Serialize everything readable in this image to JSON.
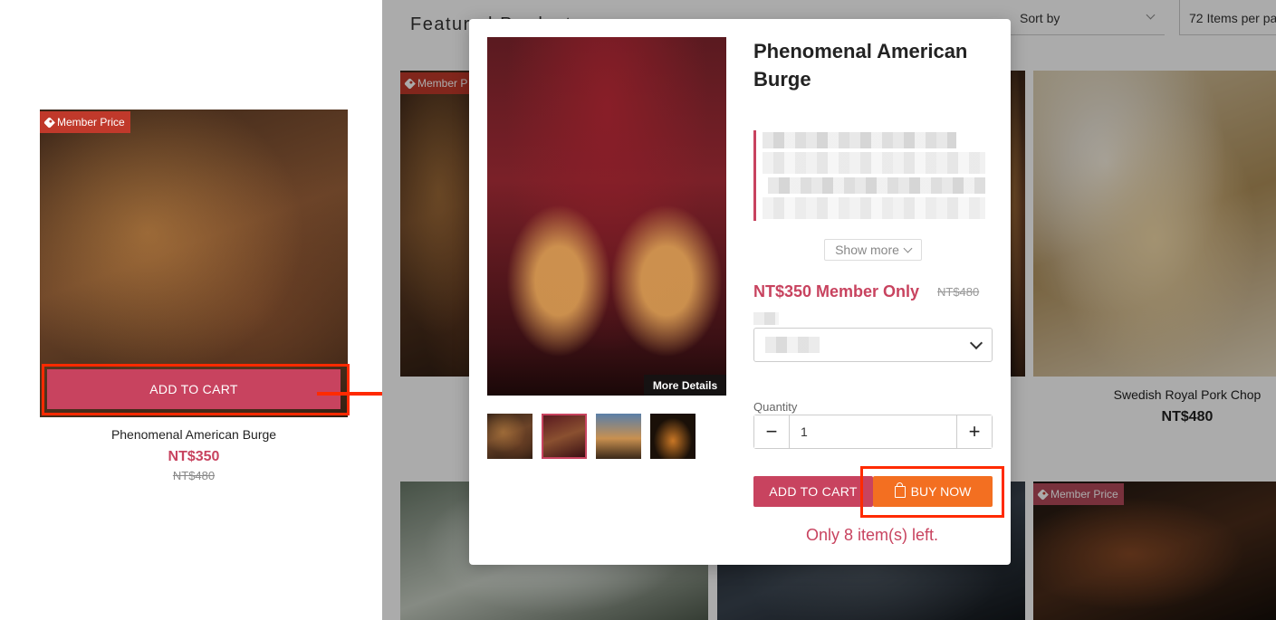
{
  "left_card": {
    "badge": "Member Price",
    "add_to_cart": "ADD TO CART",
    "name": "Phenomenal American Burge",
    "price": "NT$350",
    "original_price": "NT$480"
  },
  "background_page": {
    "section_title": "Featured Products",
    "sort_label": "Sort by",
    "per_page_label": "72 Items per pa",
    "product_badge": "Member P",
    "right_product_name": "Swedish Royal Pork Chop",
    "right_product_price": "NT$480",
    "bottom_right_badge": "Member Price"
  },
  "modal": {
    "title": "Phenomenal American Burge",
    "show_more": "Show more",
    "member_price": "NT$350 Member Only",
    "original_price": "NT$480",
    "more_details": "More Details",
    "quantity_label": "Quantity",
    "quantity_value": "1",
    "add_to_cart": "ADD TO CART",
    "buy_now": "BUY NOW",
    "stock_notice": "Only 8 item(s) left."
  },
  "colors": {
    "accent": "#c8435f",
    "buy": "#f36f21",
    "badge": "#c0392b",
    "highlight": "#ff2a00"
  }
}
